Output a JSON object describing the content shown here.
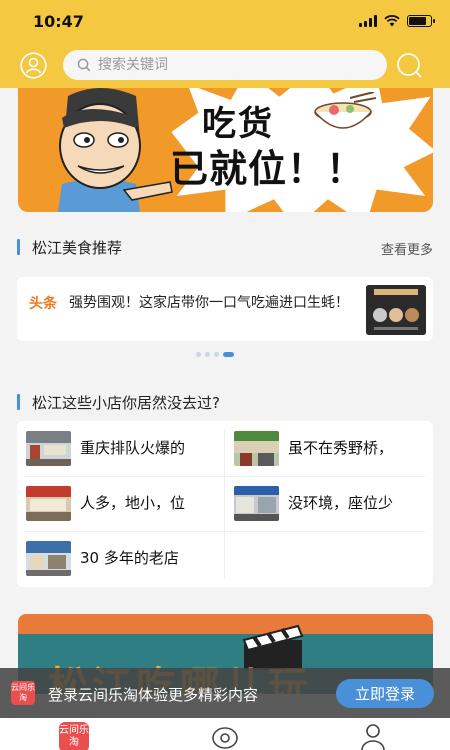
{
  "status_bar": {
    "time": "10:47"
  },
  "header": {
    "user_icon": "user-circle-icon",
    "search_placeholder": "搜索关键词",
    "search_icon": "search-icon"
  },
  "banner": {
    "line1": "吃货",
    "line2": "已就位！！"
  },
  "section_food": {
    "title": "松江美食推荐",
    "more_label": "查看更多"
  },
  "news": {
    "tag": "头条",
    "text": "强势围观！这家店带你一口气吃遍进口生蚝！"
  },
  "carousel": {
    "page_count": 4,
    "active_index": 3
  },
  "section_shops": {
    "title": "松江这些小店你居然没去过?",
    "items": [
      {
        "text": "重庆排队火爆的"
      },
      {
        "text": "虽不在秀野桥，"
      },
      {
        "text": "人多，地小，位"
      },
      {
        "text": "没环境，座位少"
      },
      {
        "text": "30 多年的老店"
      }
    ]
  },
  "banner2": {
    "text": "松江吃哪儿玩"
  },
  "login_prompt": {
    "logo_text": "云间乐淘",
    "text": "登录云间乐淘体验更多精彩内容",
    "button_label": "立即登录"
  },
  "tabbar": {
    "home_label": "云间乐淘"
  },
  "colors": {
    "header_bg": "#f5c842",
    "accent_blue": "#4a90d9",
    "tag_orange": "#f07a24",
    "brand_red": "#e94f4f"
  }
}
